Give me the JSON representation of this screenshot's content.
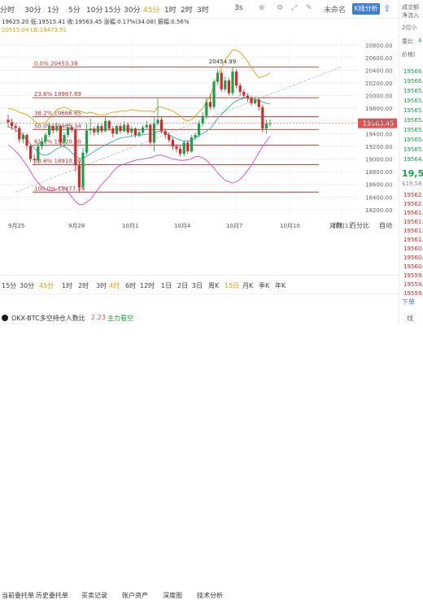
{
  "timeframes": {
    "items": [
      "分时",
      "30分",
      "1分",
      "5分",
      "10分",
      "15分",
      "30分",
      "45分",
      "1时",
      "2时",
      "3时"
    ],
    "active_index": 7,
    "label_3s": "3s",
    "unsettled_label": "未命名",
    "kline_button": "K线分析"
  },
  "indicators": {
    "row1": "19625.20  低:19515.41  收:19563.45  涨幅:0.17%(34.08)  振幅:0.56%",
    "row2": "20515.04  LB:19473.51"
  },
  "chart_data": {
    "type": "candlestick",
    "x_ticks": [
      "9月25",
      "9月28",
      "10月1",
      "10月4",
      "10月7",
      "10月10",
      "10月13"
    ],
    "y_ticks": [
      20800,
      20600,
      20400,
      20200,
      20000,
      19800,
      19600,
      19400,
      19200,
      19000,
      18800,
      18600,
      18400,
      18200
    ],
    "ylim": [
      18070,
      20920
    ],
    "fib_levels": [
      {
        "label": "0.0% 20453.38",
        "price": 20453.38,
        "color": "#cc2b2b"
      },
      {
        "label": "23.6% 19967.69",
        "price": 19967.69,
        "color": "#cc2b2b"
      },
      {
        "label": "38.2% 19666.65",
        "price": 19666.65,
        "color": "#cc2b2b"
      },
      {
        "label": "50.0% 19465.34",
        "price": 19465.34,
        "color": "#cc2b2b"
      },
      {
        "label": "61.8% 19220.30",
        "price": 19220.3,
        "color": "#cc2b2b"
      },
      {
        "label": "78.6% 18910.29",
        "price": 18910.29,
        "color": "#cc2b2b"
      },
      {
        "label": "100.0% 18477.59",
        "price": 18477.59,
        "color": "#cc2b2b"
      }
    ],
    "high_marker": "20454.99",
    "current_price": "19563.45",
    "candles": [
      [
        19620,
        19580,
        19700,
        19500
      ],
      [
        19580,
        19520,
        19640,
        19460
      ],
      [
        19520,
        19490,
        19560,
        19420
      ],
      [
        19490,
        19310,
        19520,
        19260
      ],
      [
        19310,
        19380,
        19420,
        19250
      ],
      [
        19380,
        19210,
        19400,
        19150
      ],
      [
        19210,
        19000,
        19240,
        18950
      ],
      [
        19000,
        18980,
        19080,
        18900
      ],
      [
        18980,
        19200,
        19260,
        18920
      ],
      [
        19200,
        19280,
        19340,
        19150
      ],
      [
        19280,
        19380,
        19420,
        19240
      ],
      [
        19380,
        19520,
        19580,
        19340
      ],
      [
        19520,
        19450,
        19560,
        19400
      ],
      [
        19450,
        19520,
        19580,
        19420
      ],
      [
        19520,
        19260,
        19540,
        19200
      ],
      [
        19260,
        19380,
        19420,
        19180
      ],
      [
        19380,
        19500,
        19560,
        19340
      ],
      [
        19500,
        19460,
        19540,
        19420
      ],
      [
        19460,
        18900,
        19480,
        18800
      ],
      [
        18900,
        18560,
        18960,
        18480
      ],
      [
        18560,
        19100,
        19180,
        18520
      ],
      [
        19100,
        19450,
        19560,
        19060
      ],
      [
        19450,
        19480,
        19640,
        19380
      ],
      [
        19480,
        19420,
        19520,
        19360
      ],
      [
        19420,
        19520,
        19560,
        19380
      ],
      [
        19520,
        19440,
        19560,
        19400
      ],
      [
        19440,
        19600,
        19660,
        19420
      ],
      [
        19600,
        19480,
        19620,
        19440
      ],
      [
        19480,
        19400,
        19520,
        19340
      ],
      [
        19400,
        19520,
        19540,
        19380
      ],
      [
        19520,
        19440,
        19560,
        19400
      ],
      [
        19440,
        19540,
        19600,
        19420
      ],
      [
        19540,
        19420,
        19580,
        19380
      ],
      [
        19420,
        19480,
        19520,
        19360
      ],
      [
        19480,
        19380,
        19500,
        19340
      ],
      [
        19380,
        19420,
        19480,
        19340
      ],
      [
        19420,
        19500,
        19540,
        19380
      ],
      [
        19500,
        19540,
        19600,
        19460
      ],
      [
        19540,
        19260,
        19560,
        19220
      ],
      [
        19260,
        19560,
        19660,
        19120
      ],
      [
        19560,
        19620,
        19960,
        19520
      ],
      [
        19620,
        19440,
        19660,
        19400
      ],
      [
        19440,
        19380,
        19480,
        19320
      ],
      [
        19380,
        19300,
        19420,
        19260
      ],
      [
        19300,
        19200,
        19340,
        19140
      ],
      [
        19200,
        19160,
        19240,
        19100
      ],
      [
        19160,
        19080,
        19220,
        19040
      ],
      [
        19080,
        19260,
        19300,
        19040
      ],
      [
        19260,
        19120,
        19300,
        19080
      ],
      [
        19120,
        19340,
        19380,
        19100
      ],
      [
        19340,
        19380,
        19420,
        19300
      ],
      [
        19380,
        19560,
        19600,
        19340
      ],
      [
        19560,
        19680,
        19740,
        19520
      ],
      [
        19680,
        19900,
        19960,
        19640
      ],
      [
        19900,
        19820,
        20020,
        19780
      ],
      [
        19820,
        20220,
        20260,
        19780
      ],
      [
        20220,
        20360,
        20420,
        20180
      ],
      [
        20360,
        20100,
        20400,
        20060
      ],
      [
        20100,
        20240,
        20300,
        20060
      ],
      [
        20240,
        20040,
        20280,
        20000
      ],
      [
        20040,
        20380,
        20455,
        20000
      ],
      [
        20380,
        20160,
        20420,
        20120
      ],
      [
        20160,
        20060,
        20200,
        20000
      ],
      [
        20060,
        20000,
        20100,
        19960
      ],
      [
        20000,
        19960,
        20040,
        19900
      ],
      [
        19960,
        19880,
        20000,
        19840
      ],
      [
        19880,
        19940,
        19980,
        19860
      ],
      [
        19940,
        19820,
        19960,
        19760
      ],
      [
        19820,
        19480,
        19860,
        19420
      ],
      [
        19480,
        19560,
        19620,
        19400
      ],
      [
        19560,
        19563,
        19625,
        19515
      ]
    ],
    "bollinger_upper": [
      19800,
      19790,
      19770,
      19740,
      19720,
      19700,
      19660,
      19600,
      19560,
      19560,
      19580,
      19640,
      19700,
      19780,
      19800,
      19820,
      19800,
      19760,
      19760,
      19760,
      19740,
      19720,
      19740,
      19720,
      19700,
      19700,
      19700,
      19720,
      19740,
      19740,
      19760,
      19760,
      19760,
      19780,
      19770,
      19760,
      19760,
      19760,
      19760,
      19740,
      19820,
      19820,
      19800,
      19780,
      19760,
      19720,
      19680,
      19620,
      19600,
      19620,
      19680,
      19740,
      19800,
      19900,
      20000,
      20160,
      20320,
      20440,
      20560,
      20640,
      20720,
      20720,
      20680,
      20620,
      20540,
      20440,
      20360,
      20280,
      20300,
      20320,
      20360
    ],
    "bollinger_lower": [
      19220,
      19180,
      19120,
      19060,
      18980,
      18900,
      18800,
      18700,
      18620,
      18560,
      18520,
      18500,
      18500,
      18520,
      18560,
      18560,
      18480,
      18400,
      18330,
      18280,
      18280,
      18320,
      18360,
      18440,
      18520,
      18600,
      18660,
      18720,
      18800,
      18860,
      18900,
      18920,
      18940,
      18960,
      18980,
      18990,
      19000,
      19010,
      19020,
      19040,
      19060,
      19060,
      19040,
      19020,
      19000,
      18990,
      18980,
      18980,
      18990,
      19000,
      19040,
      19040,
      19020,
      18980,
      18920,
      18860,
      18780,
      18720,
      18660,
      18640,
      18620,
      18640,
      18680,
      18740,
      18820,
      18900,
      19000,
      19100,
      19200,
      19280,
      19360
    ],
    "bollinger_mid": [
      19510,
      19490,
      19460,
      19420,
      19370,
      19310,
      19240,
      19170,
      19110,
      19070,
      19060,
      19080,
      19120,
      19160,
      19190,
      19200,
      19160,
      19100,
      19050,
      19010,
      19010,
      19040,
      19080,
      19120,
      19160,
      19190,
      19220,
      19250,
      19280,
      19310,
      19330,
      19340,
      19350,
      19360,
      19370,
      19370,
      19380,
      19390,
      19390,
      19390,
      19440,
      19430,
      19410,
      19380,
      19350,
      19320,
      19300,
      19280,
      19280,
      19290,
      19330,
      19370,
      19400,
      19440,
      19480,
      19560,
      19640,
      19700,
      19760,
      19820,
      19880,
      19920,
      19940,
      19960,
      19960,
      19950,
      19940,
      19920,
      19900,
      19880,
      19870
    ],
    "dashed_support_start": [
      18477.59,
      2
    ],
    "dashed_support_end": [
      20453.38,
      89
    ]
  },
  "axis_controls": {
    "log_label": "对数",
    "percent_label": "百分比",
    "auto_label": "自动"
  },
  "timeframes_bottom": {
    "items": [
      "15分",
      "30分",
      "45分",
      "1时",
      "2时",
      "3时",
      "4时",
      "6时",
      "12时",
      "1日",
      "2日",
      "3日",
      "周K",
      "15日",
      "月K",
      "季K",
      "年K"
    ],
    "active_index": 6
  },
  "tabs": {
    "items": [
      "当前委托单",
      "历史委托单",
      "买卖记录",
      "账户资产",
      "深度图",
      "技术分析"
    ]
  },
  "ratio": {
    "label": "OKX-BTC多空持仓人数比",
    "value": "2.23",
    "tag": "主力看空"
  },
  "right_panel": {
    "header1": "成交额",
    "header2": "净流入",
    "header3": "2位小",
    "label_ratio": "委比",
    "value_ratio": "4",
    "price_label": "价格(",
    "big_price": "19,5",
    "sub_price": "$19,58",
    "bottom_button": "下单",
    "bottom_link": "线"
  },
  "order_book": {
    "asks": [
      "19566.1",
      "19566.0",
      "19565.8",
      "19565.7",
      "19565.6",
      "19565.5",
      "19565.3",
      "19565.2",
      "19565.0",
      "19564.8"
    ],
    "bids": [
      "19562.1",
      "19562.0",
      "19561.9",
      "19561.5",
      "19561.2",
      "19561.0",
      "19560.8",
      "19560.5",
      "19560.0",
      "19559.8",
      "19559.5",
      "19559.0"
    ]
  },
  "colors": {
    "up": "#16a34a",
    "down": "#dc2626",
    "fib": "#c0392b",
    "bb_upper": "#e0a100",
    "bb_lower": "#d04fbf",
    "bb_mid": "#2ab3a6",
    "accent": "#3d7bd9",
    "price_tag": "#e05353"
  }
}
